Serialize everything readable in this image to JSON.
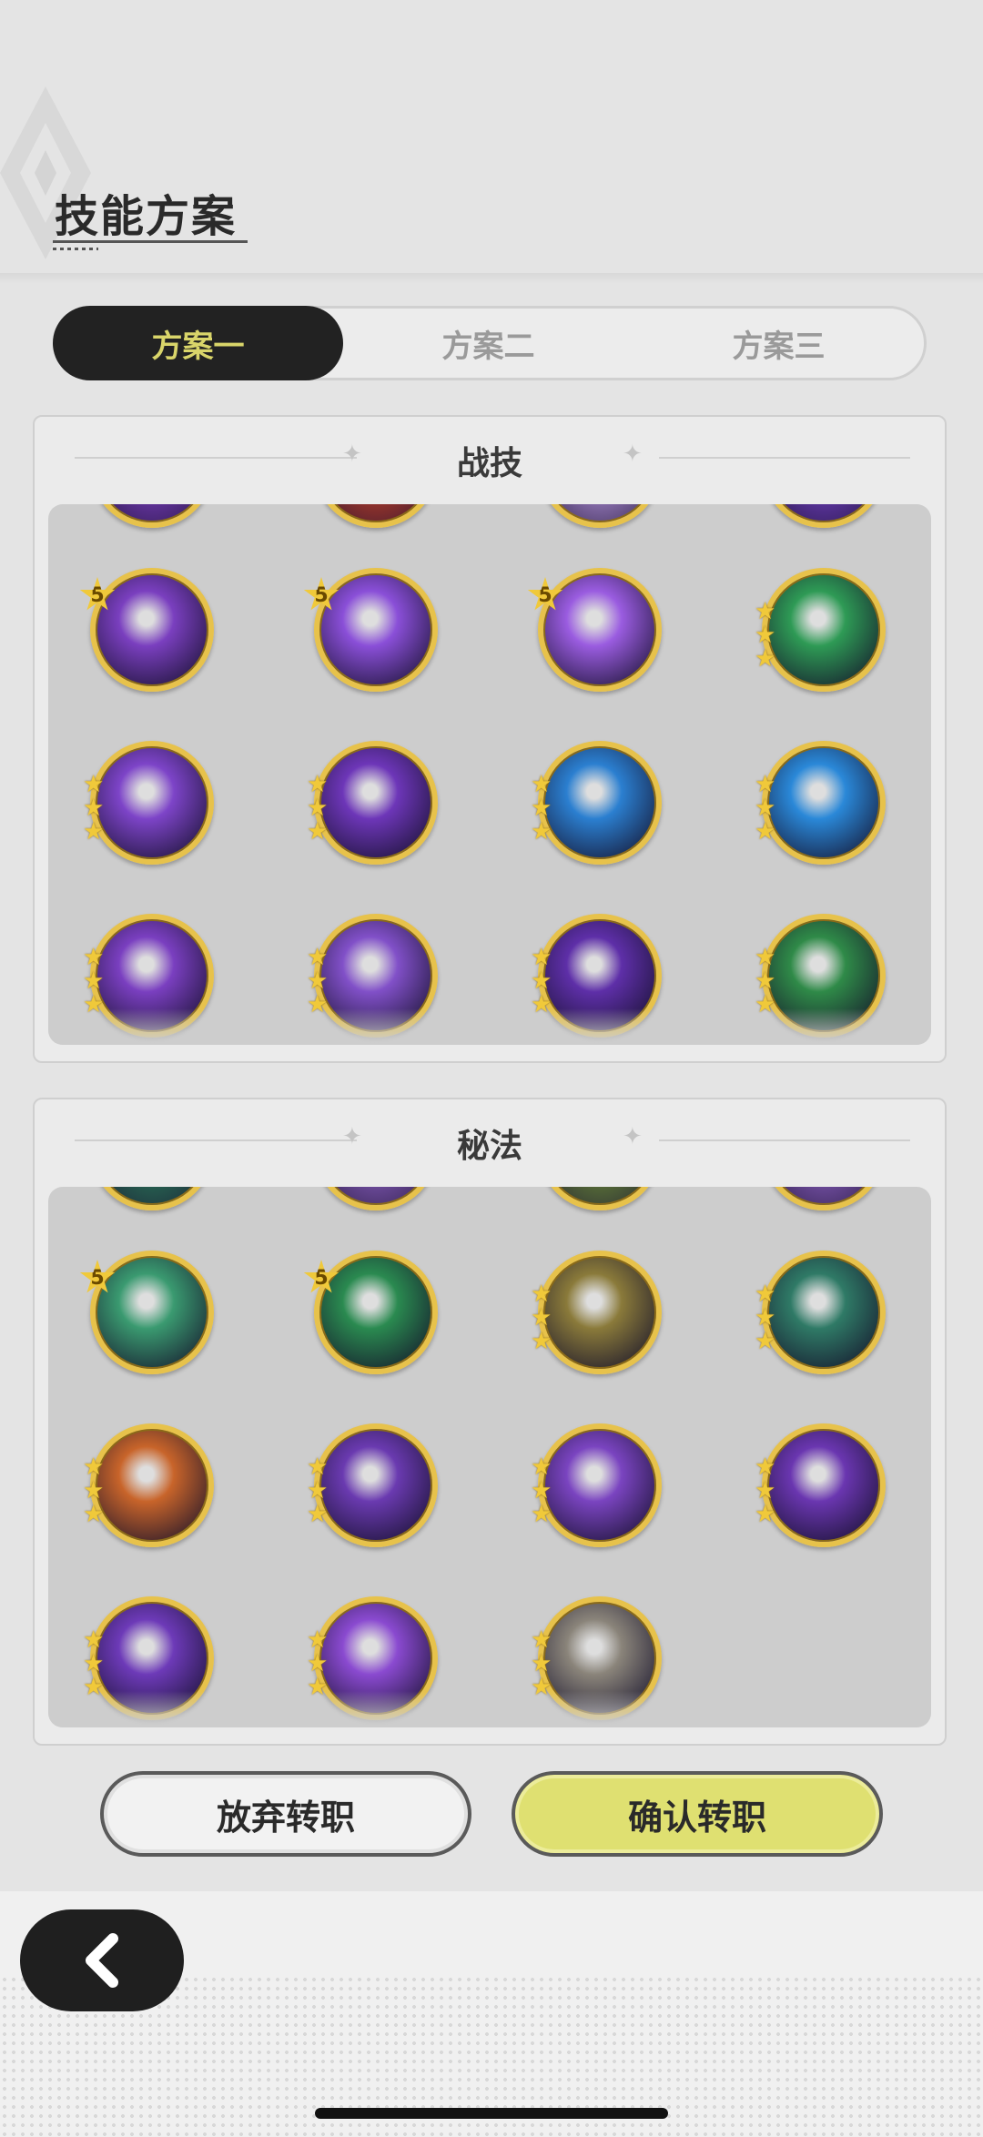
{
  "header": {
    "title": "技能方案"
  },
  "tabs": [
    {
      "label": "方案一",
      "active": true
    },
    {
      "label": "方案二",
      "active": false
    },
    {
      "label": "方案三",
      "active": false
    }
  ],
  "combat_section": {
    "title": "战技"
  },
  "arcane_section": {
    "title": "秘法"
  },
  "combat_skills": [
    {
      "icon": "purple-orb-skill-icon",
      "color": "#7a3fbf",
      "level_badge": "5"
    },
    {
      "icon": "purple-slash-skill-icon",
      "color": "#8a4fd8",
      "level_badge": "5"
    },
    {
      "icon": "purple-mask-skill-icon",
      "color": "#9a5ce0",
      "level_badge": "5"
    },
    {
      "icon": "green-flame-skill-icon",
      "color": "#2e9a55",
      "stars": 3
    },
    {
      "icon": "purple-vortex-skill-icon",
      "color": "#7d44c8",
      "stars": 3
    },
    {
      "icon": "purple-crest-skill-icon",
      "color": "#6d36b8",
      "stars": 3
    },
    {
      "icon": "blue-golem-skill-icon",
      "color": "#2b7fd0",
      "stars": 3
    },
    {
      "icon": "blue-beast-skill-icon",
      "color": "#2a88d8",
      "stars": 3
    },
    {
      "icon": "purple-blade-skill-icon",
      "color": "#7a3fc0",
      "stars": 3
    },
    {
      "icon": "purple-spiral-skill-icon",
      "color": "#8150c8",
      "stars": 3
    },
    {
      "icon": "purple-star-skill-icon",
      "color": "#5e2fa8",
      "stars": 3
    },
    {
      "icon": "green-vine-skill-icon",
      "color": "#2f8a48",
      "stars": 3
    }
  ],
  "arcane_skills": [
    {
      "icon": "green-rune-skill-icon",
      "color": "#3a9a70",
      "level_badge": "5"
    },
    {
      "icon": "green-pillar-skill-icon",
      "color": "#2a8a50",
      "level_badge": "5"
    },
    {
      "icon": "gold-leaf-skill-icon",
      "color": "#8a7a3a",
      "stars": 3
    },
    {
      "icon": "teal-figure-skill-icon",
      "color": "#2f7a66",
      "stars": 3
    },
    {
      "icon": "orange-beast-skill-icon",
      "color": "#c8642a",
      "stars": 3
    },
    {
      "icon": "purple-orbit-skill-icon",
      "color": "#6a3ab0",
      "stars": 3
    },
    {
      "icon": "purple-eye-skill-icon",
      "color": "#7a44c0",
      "stars": 3
    },
    {
      "icon": "purple-arm-skill-icon",
      "color": "#6a36b0",
      "stars": 3
    },
    {
      "icon": "purple-cross-skill-icon",
      "color": "#6d3ab8",
      "stars": 3
    },
    {
      "icon": "purple-triangle-skill-icon",
      "color": "#8a4ad0",
      "stars": 3
    },
    {
      "icon": "grey-beast-skill-icon",
      "color": "#8a847a",
      "stars": 3
    }
  ],
  "actions": {
    "cancel_label": "放弃转职",
    "confirm_label": "确认转职"
  },
  "colors": {
    "accent": "#dfe071",
    "tab_active_text": "#d9d56a",
    "gold_frame": "#e7c24b"
  }
}
